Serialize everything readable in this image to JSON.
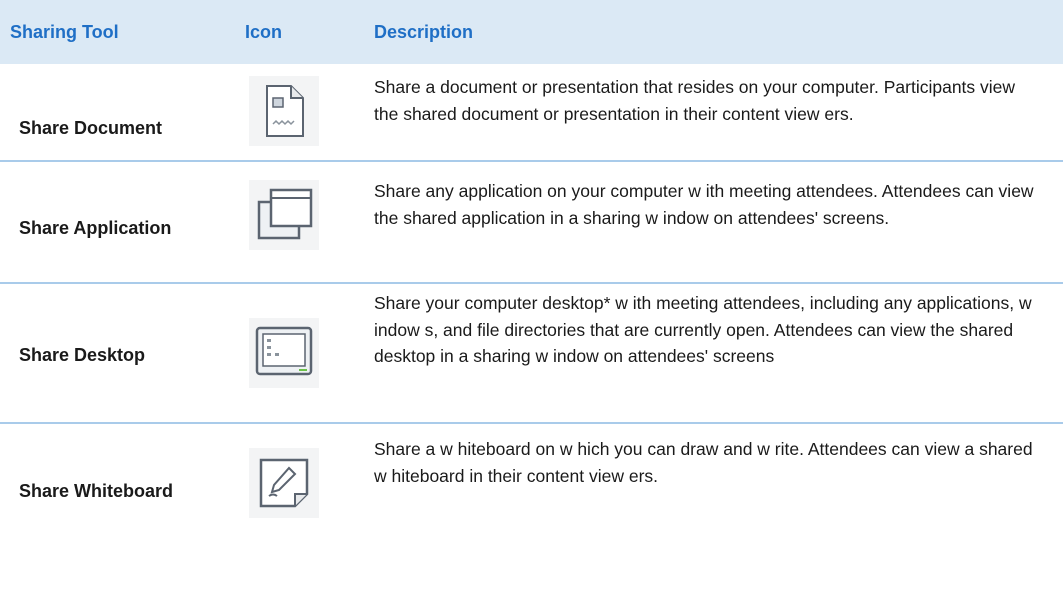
{
  "header": {
    "col_tool": "Sharing Tool",
    "col_icon": "Icon",
    "col_description": "Description"
  },
  "rows": [
    {
      "tool": "Share Document",
      "icon": "document-icon",
      "description": "Share a document or presentation that resides on your computer. Participants view the shared document or presentation in their content view ers."
    },
    {
      "tool": "Share Application",
      "icon": "application-windows-icon",
      "description": "Share any application on your computer w ith meeting attendees. Attendees can view the shared application in a sharing w indow on attendees' screens."
    },
    {
      "tool": "Share Desktop",
      "icon": "desktop-monitor-icon",
      "description": "Share your computer desktop* w ith meeting attendees, including any applications, w indow s, and file directories that are currently open. Attendees can view the shared desktop in a sharing w indow on attendees' screens"
    },
    {
      "tool": "Share Whiteboard",
      "icon": "whiteboard-pen-icon",
      "description": "Share a w hiteboard on w hich you can draw and w rite. Attendees can view a shared w hiteboard in their content view ers."
    }
  ],
  "colors": {
    "header_background": "#dbe9f5",
    "header_text": "#1f6fc6",
    "row_divider": "#a9cbea",
    "icon_stroke": "#5b6470",
    "icon_accent": "#3d7ea8"
  }
}
